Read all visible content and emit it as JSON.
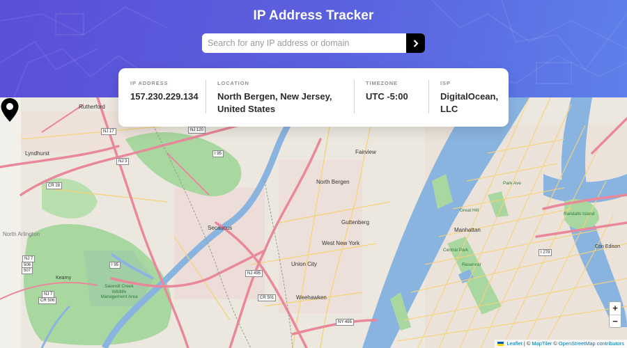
{
  "header": {
    "title": "IP Address Tracker",
    "search_placeholder": "Search for any IP address or domain",
    "gradient_colors": [
      "#5a4fd8",
      "#5d80ea"
    ]
  },
  "info": {
    "ip_label": "IP Address",
    "ip_value": "157.230.229.134",
    "location_label": "Location",
    "location_value": "North Bergen, New Jersey, United States",
    "timezone_label": "Timezone",
    "timezone_value": "UTC -5:00",
    "isp_label": "ISP",
    "isp_value": "DigitalOcean, LLC"
  },
  "map": {
    "places": {
      "rutherford": "Rutherford",
      "lyndhurst": "Lyndhurst",
      "north_arlington": "North Arlington",
      "secaucus": "Secaucus",
      "fairview": "Fairview",
      "north_bergen": "North Bergen",
      "guttenberg": "Guttenberg",
      "west_new_york": "West New York",
      "union_city": "Union City",
      "weehawken": "Weehawken",
      "manhattan": "Manhattan",
      "con_edison": "Con Edison",
      "kearny": "Kearny"
    },
    "parks": {
      "sawmill": "Sawmill Creek Wildlife Management Area",
      "central_park": "Central Park",
      "great_hill": "Great Hill",
      "randalls": "Randalls Island",
      "park_ave": "Park Ave",
      "reservoir": "Reservoir"
    },
    "shields": {
      "nj17": "NJ 17",
      "nj120": "NJ 120",
      "i95a": "I 95",
      "nj3": "NJ 3",
      "cr28": "CR 28",
      "i95b": "I 95",
      "nj495": "NJ 495",
      "nj7": "NJ 7",
      "cr506": "506",
      "cr507": "507",
      "nj7b": "NJ 7",
      "cr506b": "CR 506",
      "cr501": "CR 501",
      "ny495": "NY 495",
      "i278": "I 278"
    },
    "marker_icon": "location-pin-icon",
    "zoom_in": "+",
    "zoom_out": "−",
    "attribution": {
      "leaflet": "Leaflet",
      "sep1": "|",
      "copy1": "©",
      "maptiler": "MapTiler",
      "copy2": "©",
      "osm": "OpenStreetMap contributors"
    }
  },
  "colors": {
    "water": "#8ab4e0",
    "park": "#a9d7a0",
    "major_road": "#e8889a",
    "minor_road": "#f6d37a",
    "land": "#ece8df"
  }
}
